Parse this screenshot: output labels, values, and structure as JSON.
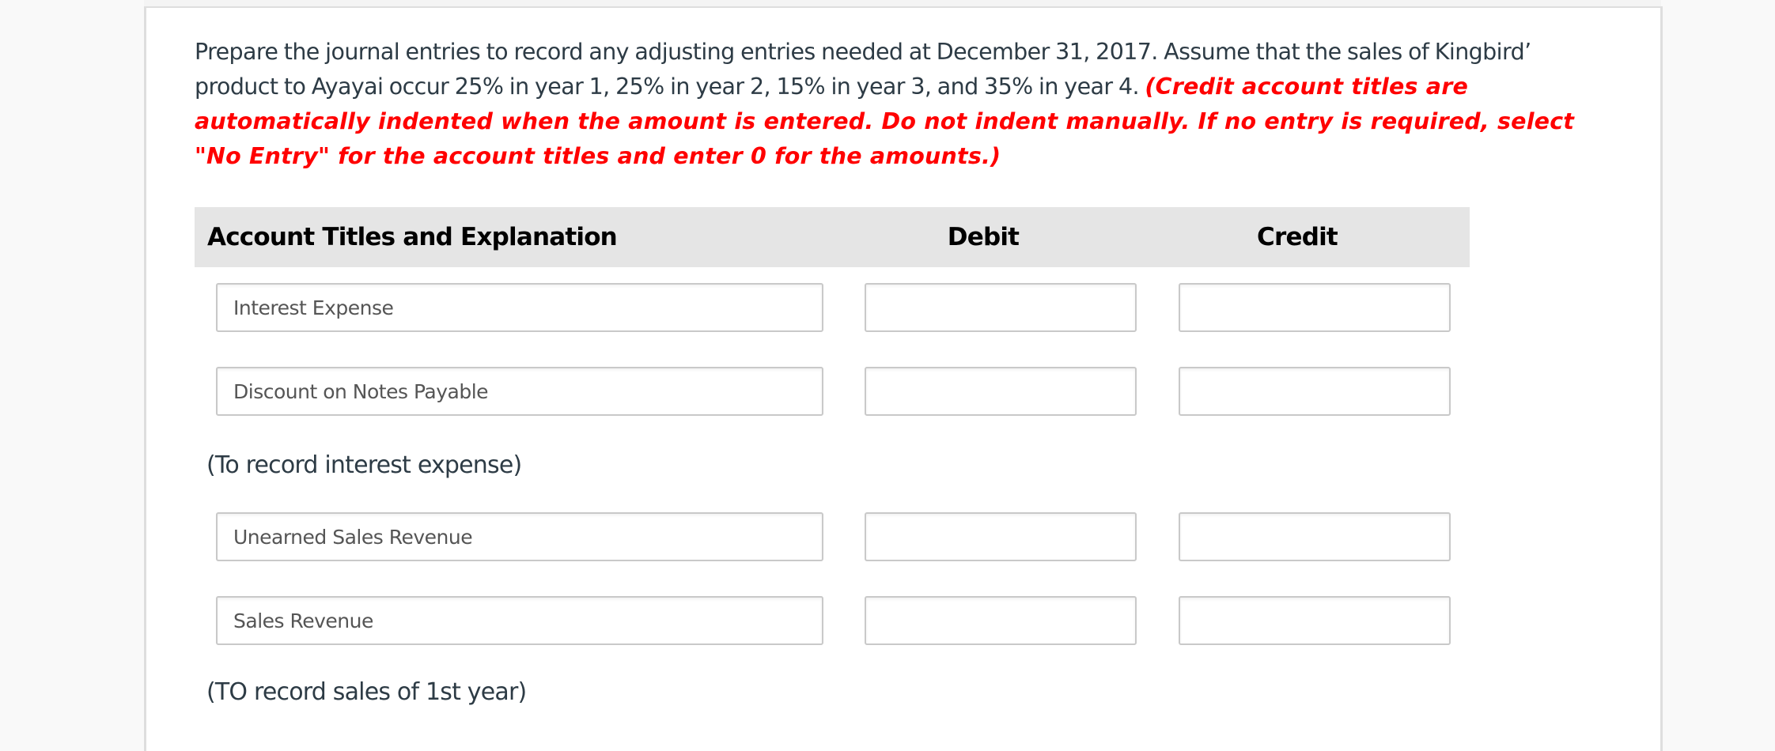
{
  "question": {
    "text": "Prepare the journal entries to record any adjusting entries needed at December 31, 2017. Assume that the sales of Kingbird’ product to Ayayai occur 25% in year 1, 25% in year 2, 15% in year 3, and 35% in year 4.",
    "instructions": "(Credit account titles are automatically indented when the amount is entered. Do not indent manually. If no entry is required, select \"No Entry\" for the account titles and enter 0 for the amounts.)",
    "instruction_color": "#ff0000"
  },
  "table": {
    "headers": {
      "account": "Account Titles and Explanation",
      "debit": "Debit",
      "credit": "Credit"
    },
    "entries": [
      {
        "rows": [
          {
            "account": "Interest Expense",
            "debit": "",
            "credit": ""
          },
          {
            "account": "Discount on Notes Payable",
            "debit": "",
            "credit": ""
          }
        ],
        "explanation": "(To record interest expense)"
      },
      {
        "rows": [
          {
            "account": "Unearned Sales Revenue",
            "debit": "",
            "credit": ""
          },
          {
            "account": "Sales Revenue",
            "debit": "",
            "credit": ""
          }
        ],
        "explanation": "(TO record sales of 1st year)"
      }
    ]
  }
}
